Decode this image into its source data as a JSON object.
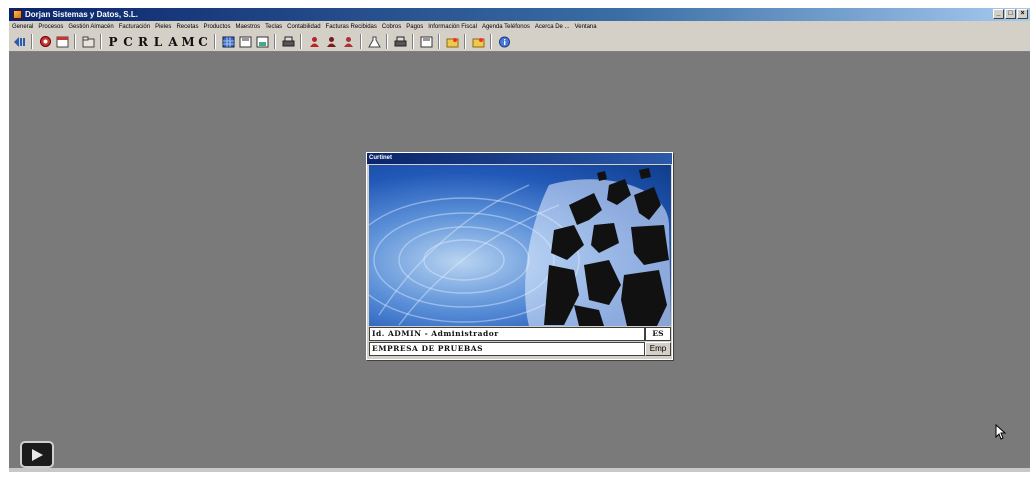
{
  "window": {
    "title": "Dorjan Sistemas y Datos, S.L.",
    "buttons": [
      "_",
      "□",
      "×"
    ]
  },
  "menu": [
    "General",
    "Procesos",
    "Gestión Almacén",
    "Facturación",
    "Pieles",
    "Recetas",
    "Productos",
    "Maestros",
    "Teclas",
    "Contabilidad",
    "Facturas Recibidas",
    "Cobros",
    "Pagos",
    "Información Fiscal",
    "Agenda Teléfonos",
    "Acerca De ...",
    "Ventana"
  ],
  "toolbar": {
    "letters": [
      "P",
      "C",
      "R",
      "L",
      "A",
      "M",
      "C"
    ]
  },
  "dialog": {
    "title": "Curtinet",
    "user": "Id. ADMIN  - Administrador",
    "lang": "ES",
    "company": "EMPRESA DE PRUEBAS",
    "emp_button": "Emp"
  },
  "colors": {
    "desktop": "#7a7a7a",
    "titlebar": "#0a246a",
    "face": "#d4d0c8"
  },
  "icons": [
    "back-icon",
    "tools-icon",
    "window-icon",
    "folder-icon",
    "grid-icon",
    "save-icon",
    "printer-icon",
    "person-icon",
    "flask-icon",
    "folder-open-icon",
    "info-icon",
    "play-icon",
    "cursor-icon"
  ]
}
